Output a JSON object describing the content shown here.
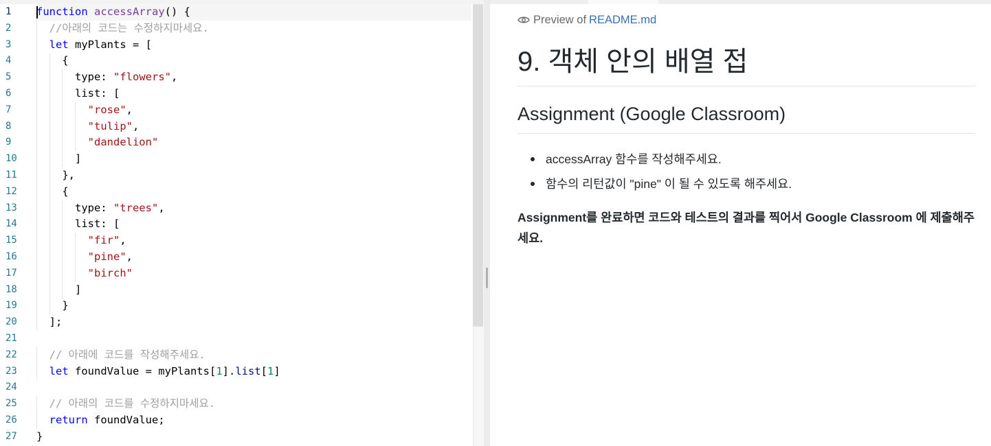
{
  "editor": {
    "line_numbers": [
      "1",
      "2",
      "3",
      "4",
      "5",
      "6",
      "7",
      "8",
      "9",
      "10",
      "11",
      "12",
      "13",
      "14",
      "15",
      "16",
      "17",
      "18",
      "19",
      "20",
      "21",
      "22",
      "23",
      "24",
      "25",
      "26",
      "27"
    ],
    "lines": [
      [
        [
          "kw",
          "function"
        ],
        [
          "t",
          " "
        ],
        [
          "fnp",
          "accessArray"
        ],
        [
          "t",
          "() {"
        ]
      ],
      [
        [
          "t",
          "  "
        ],
        [
          "cmt",
          "//아래의 코드는 수정하지마세요."
        ]
      ],
      [
        [
          "t",
          "  "
        ],
        [
          "kw",
          "let"
        ],
        [
          "t",
          " myPlants = ["
        ]
      ],
      [
        [
          "t",
          "    {"
        ]
      ],
      [
        [
          "t",
          "      "
        ],
        [
          "t",
          "type"
        ],
        [
          "t",
          ": "
        ],
        [
          "str",
          "\"flowers\""
        ],
        [
          "t",
          ","
        ]
      ],
      [
        [
          "t",
          "      "
        ],
        [
          "t",
          "list"
        ],
        [
          "t",
          ": ["
        ]
      ],
      [
        [
          "t",
          "        "
        ],
        [
          "str",
          "\"rose\""
        ],
        [
          "t",
          ","
        ]
      ],
      [
        [
          "t",
          "        "
        ],
        [
          "str",
          "\"tulip\""
        ],
        [
          "t",
          ","
        ]
      ],
      [
        [
          "t",
          "        "
        ],
        [
          "str",
          "\"dandelion\""
        ]
      ],
      [
        [
          "t",
          "      ]"
        ]
      ],
      [
        [
          "t",
          "    },"
        ]
      ],
      [
        [
          "t",
          "    {"
        ]
      ],
      [
        [
          "t",
          "      "
        ],
        [
          "t",
          "type"
        ],
        [
          "t",
          ": "
        ],
        [
          "str",
          "\"trees\""
        ],
        [
          "t",
          ","
        ]
      ],
      [
        [
          "t",
          "      "
        ],
        [
          "t",
          "list"
        ],
        [
          "t",
          ": ["
        ]
      ],
      [
        [
          "t",
          "        "
        ],
        [
          "str",
          "\"fir\""
        ],
        [
          "t",
          ","
        ]
      ],
      [
        [
          "t",
          "        "
        ],
        [
          "str",
          "\"pine\""
        ],
        [
          "t",
          ","
        ]
      ],
      [
        [
          "t",
          "        "
        ],
        [
          "str",
          "\"birch\""
        ]
      ],
      [
        [
          "t",
          "      ]"
        ]
      ],
      [
        [
          "t",
          "    }"
        ]
      ],
      [
        [
          "t",
          "  ];"
        ]
      ],
      [
        [
          "t",
          ""
        ]
      ],
      [
        [
          "t",
          "  "
        ],
        [
          "cmt",
          "// 아래에 코드를 작성해주세요."
        ]
      ],
      [
        [
          "t",
          "  "
        ],
        [
          "kw",
          "let"
        ],
        [
          "t",
          " foundValue = myPlants["
        ],
        [
          "num",
          "1"
        ],
        [
          "t",
          "]."
        ],
        [
          "prop",
          "list"
        ],
        [
          "t",
          "["
        ],
        [
          "num",
          "1"
        ],
        [
          "t",
          "]"
        ]
      ],
      [
        [
          "t",
          ""
        ]
      ],
      [
        [
          "t",
          "  "
        ],
        [
          "cmt",
          "// 아래의 코드를 수정하지마세요."
        ]
      ],
      [
        [
          "t",
          "  "
        ],
        [
          "kw",
          "return"
        ],
        [
          "t",
          " foundValue;"
        ]
      ],
      [
        [
          "t",
          "}"
        ]
      ]
    ],
    "colors": {
      "keyword": "#0000ff",
      "function": "#7a3e9d",
      "string": "#a31515",
      "number": "#098658",
      "comment": "#a0a0a0",
      "line_number": "#237893"
    }
  },
  "preview": {
    "prefix": "Preview of",
    "file": "README.md",
    "h1": "9. 객체 안의 배열 접",
    "h2": "Assignment (Google Classroom)",
    "items": [
      "accessArray 함수를 작성해주세요.",
      "함수의 리턴값이 \"pine\" 이 될 수 있도록 해주세요."
    ],
    "note": "Assignment를 완료하면 코드와 테스트의 결과를 찍어서 Google Classroom 에 제출해주세요.",
    "link_color": "#3b6fb6"
  }
}
